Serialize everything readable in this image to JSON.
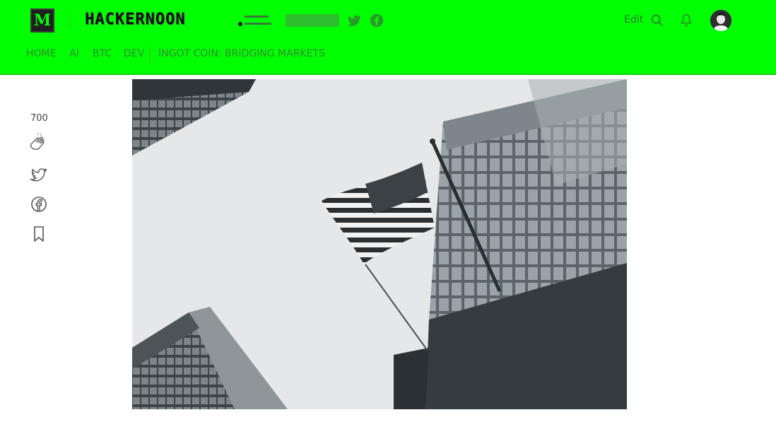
{
  "header": {
    "medium_logo": "M",
    "brand": "HACKERNOON",
    "icons": [
      "twitter-icon",
      "facebook-icon",
      "search-icon",
      "bell-icon"
    ],
    "edit_label": "Edit"
  },
  "nav": {
    "items": [
      {
        "label": "HOME"
      },
      {
        "label": "AI"
      },
      {
        "label": "BTC"
      },
      {
        "label": "DEV"
      },
      {
        "label": "INGOT COIN: BRIDGING MARKETS"
      }
    ]
  },
  "sidebar": {
    "clap_count": "700",
    "icons": [
      "clap-icon",
      "twitter-icon",
      "facebook-icon",
      "bookmark-icon"
    ]
  },
  "colors": {
    "header_bg": "#00ff00",
    "nav_text": "#2d8f2d",
    "page_bg": "#ffffff"
  }
}
